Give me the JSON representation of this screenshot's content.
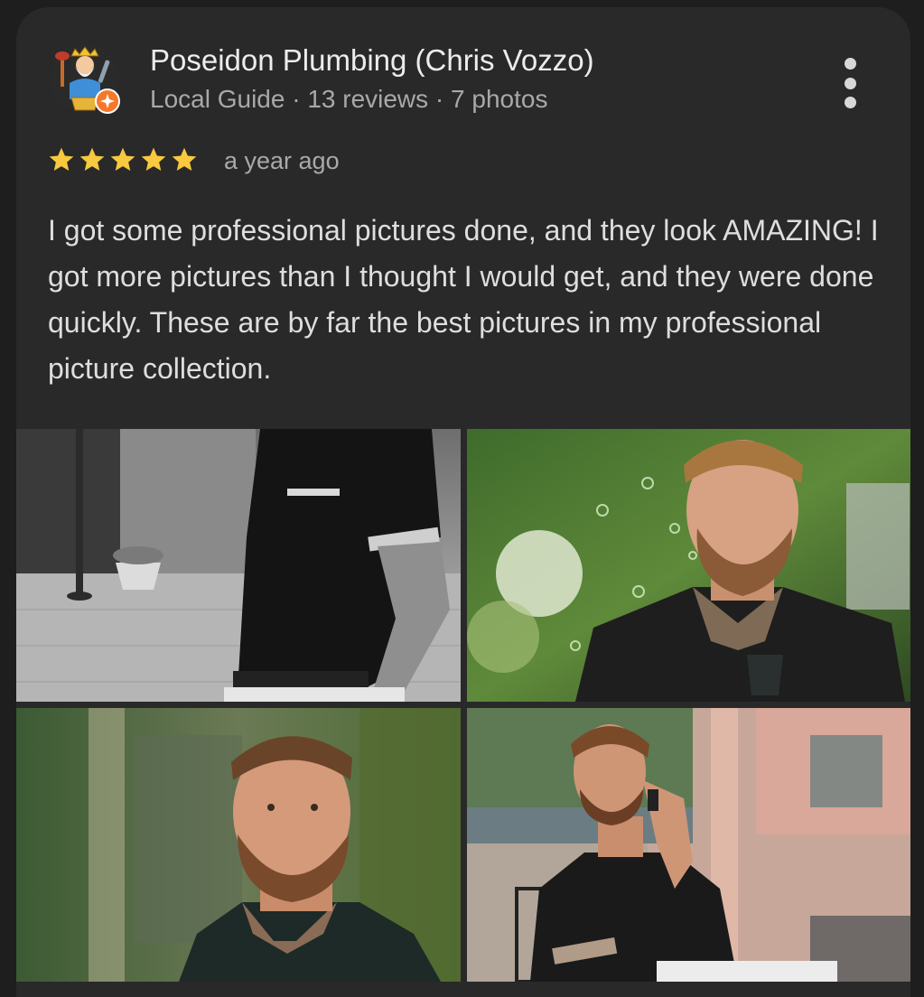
{
  "review": {
    "author": "Poseidon Plumbing (Chris Vozzo)",
    "author_meta": "Local Guide · 13 reviews · 7 photos",
    "rating": 5,
    "rating_max": 5,
    "date": "a year ago",
    "text": "I got some professional pictures done, and they look AMAZING! I got more pictures than I thought I would get, and they were done quickly. These are by far the best pictures in my professional picture collection.",
    "avatar_icon": "poseidon-mascot-avatar",
    "local_guide_badge_icon": "local-guide-star-badge",
    "more_icon": "more-vert-icon",
    "photos": [
      {
        "name": "photo-1",
        "description": "black and white, man in black polo, torso"
      },
      {
        "name": "photo-2",
        "description": "man with beard looking down, trees background"
      },
      {
        "name": "photo-3",
        "description": "man with beard looking sideways, green background"
      },
      {
        "name": "photo-4",
        "description": "man sitting on phone at outdoor cafe"
      }
    ]
  },
  "colors": {
    "card_bg": "#292929",
    "page_bg": "#1e1e1e",
    "star": "#f8c93e",
    "primary_text": "#ececec",
    "secondary_text": "#a9a9a9",
    "badge": "#f5782a"
  }
}
